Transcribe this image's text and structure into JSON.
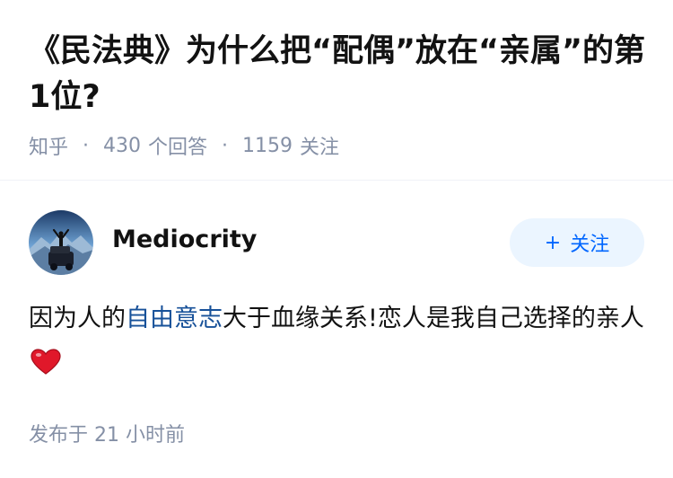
{
  "question": {
    "title": "《民法典》为什么把“配偶”放在“亲属”的第1位?",
    "source": "知乎",
    "answer_count": "430",
    "answer_label": "个回答",
    "follower_count": "1159",
    "follower_label": "关注"
  },
  "answer": {
    "author_name": "Mediocrity",
    "follow_label": "关注",
    "follow_icon": "plus-icon",
    "avatar_icon": "mountain-jeep-avatar",
    "content_before": "因为人的",
    "content_link": "自由意志",
    "content_after": "大于血缘关系!恋人是我自己选择的亲人",
    "emoji": "heart-icon",
    "published": "发布于 21 小时前"
  },
  "colors": {
    "title": "#121212",
    "meta": "#8590a6",
    "link": "#175199",
    "follow_bg": "#ebf5ff",
    "follow_text": "#0066ff",
    "heart": "#e0182a"
  }
}
